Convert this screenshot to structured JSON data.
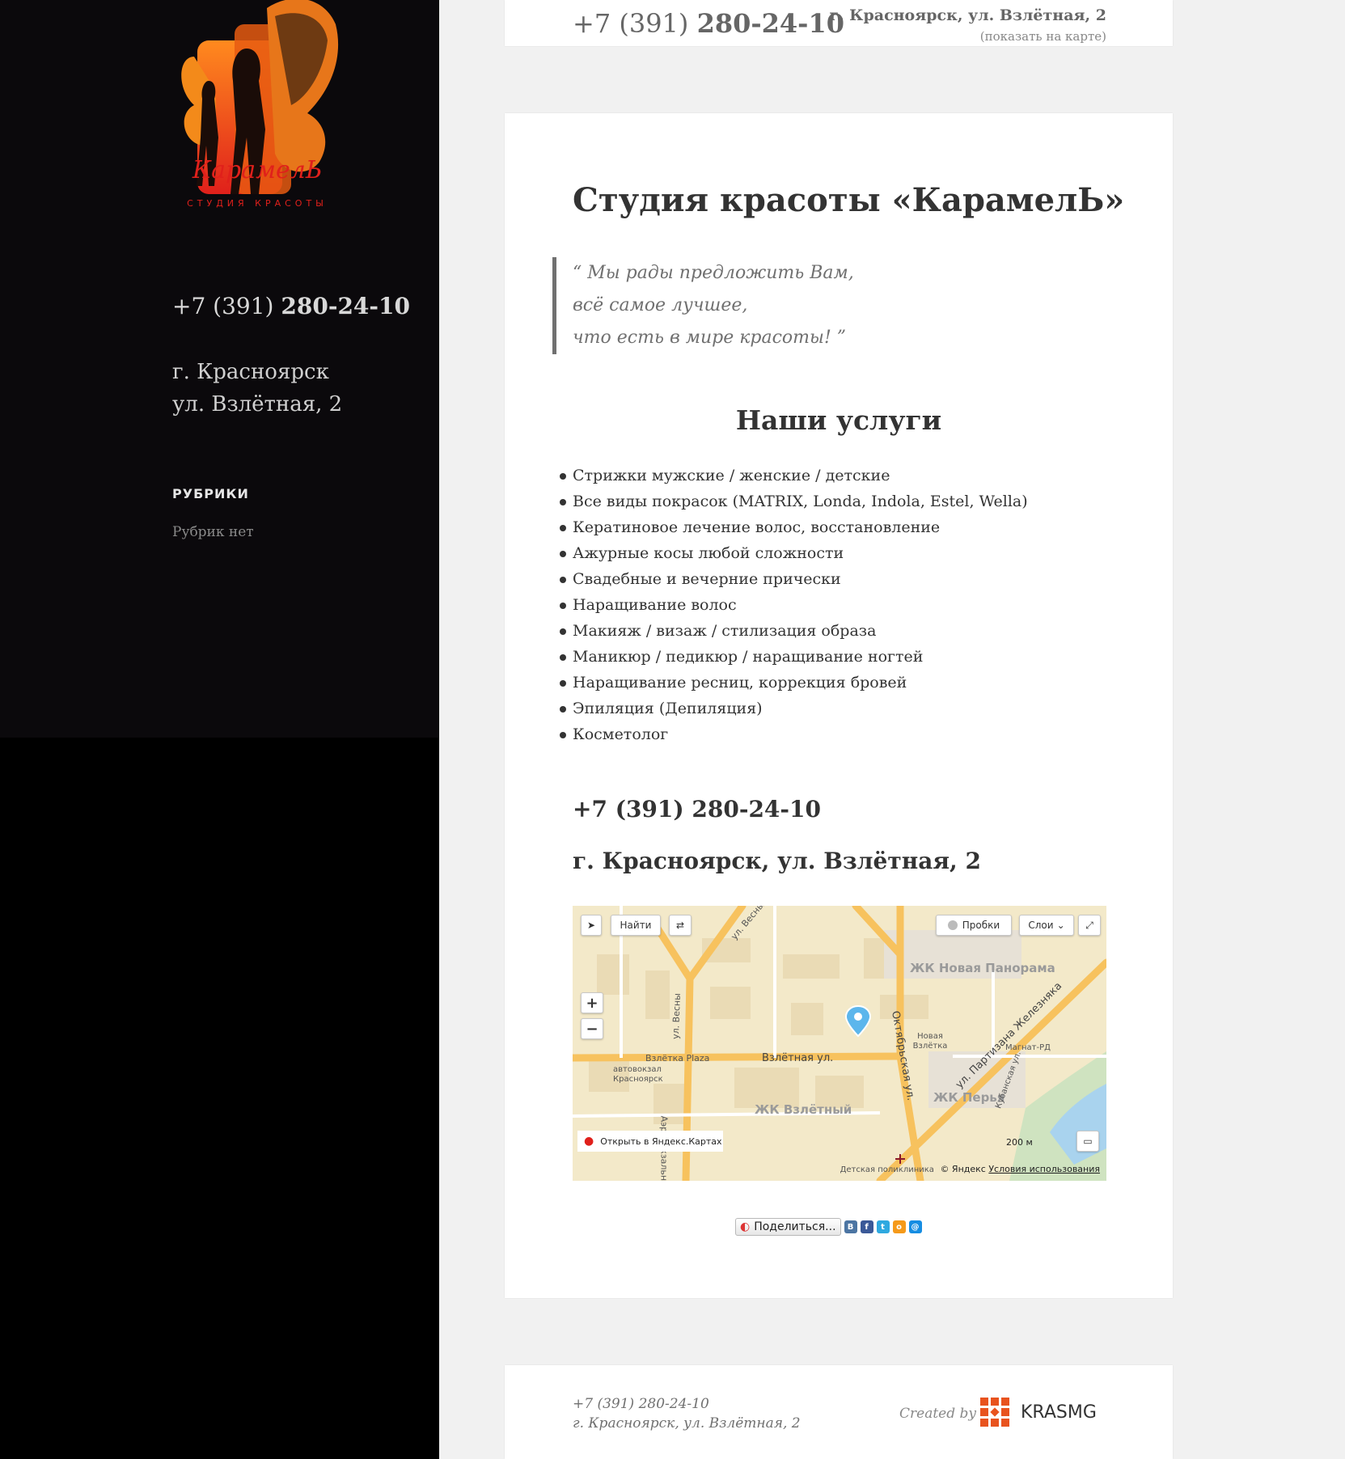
{
  "sidebar": {
    "logo_name": "КарамелЬ",
    "logo_subtitle": "СТУДИЯ КРАСОТЫ",
    "phone_prefix": "+7 (391) ",
    "phone_number": "280-24-10",
    "address_line1": "г. Красноярск",
    "address_line2": "ул. Взлётная, 2",
    "rubrics_heading": "РУБРИКИ",
    "rubrics_empty": "Рубрик нет"
  },
  "header_card": {
    "phone_prefix": "+7 (391) ",
    "phone_number": "280-24-10",
    "address": "г. Красноярск, ул. Взлётная, 2",
    "map_link": "(показать на карте)"
  },
  "main": {
    "title": "Студия красоты «КарамелЬ»",
    "quote_lines": [
      "“ Мы рады предложить Вам,",
      "всё самое лучшее,",
      "что есть в мире красоты! ”"
    ],
    "services_title": "Наши услуги",
    "services": [
      "Стрижки мужские / женские / детские",
      "Все виды покрасок (MATRIX, Londa, Indola, Estel, Wella)",
      "Кератиновое лечение волос, восстановление",
      "Ажурные косы любой сложности",
      "Свадебные и вечерние прически",
      "Наращивание волос",
      "Макияж / визаж / стилизация образа",
      "Маникюр / педикюр / наращивание ногтей",
      "Наращивание ресниц, коррекция бровей",
      "Эпиляция (Депиляция)",
      "Косметолог"
    ],
    "contact_phone": "+7 (391) 280-24-10",
    "contact_address": "г. Красноярск, ул. Взлётная, 2"
  },
  "map": {
    "find_button": "Найти",
    "traffic_button": "Пробки",
    "layers_button": "Слои",
    "open_link": "Открыть в Яндекс.Картах",
    "copyright": "© Яндекс",
    "terms": "Условия использования",
    "scale": "200 м",
    "labels": {
      "novaya_panorama": "ЖК Новая Панорама",
      "vzletny": "ЖК Взлётный",
      "perya": "ЖК Перья",
      "vzletnaya_st": "Взлётная ул.",
      "oktyabrskaya": "Октябрьская ул.",
      "partizana": "ул. Партизана Железняка",
      "vesny1": "ул. Весны",
      "vesny2": "ул. Весны",
      "vzletka_plaza": "Взлётка Plaza",
      "avtovokzal": "автовокзал Красноярск",
      "novaya_vzletka": "Новая Взлётка",
      "magnat": "Магнат-РД",
      "kubanskaya": "Кубанская ул.",
      "poliklinika": "Детская поликлиника",
      "aerovokzal": "Аэровокзальная"
    }
  },
  "share": {
    "label": "Поделиться...",
    "icons": [
      "vk-icon",
      "facebook-icon",
      "twitter-icon",
      "odnoklassniki-icon",
      "mail-icon"
    ]
  },
  "footer": {
    "phone": "+7 (391) 280-24-10",
    "address": "г. Красноярск, ул. Взлётная, 2",
    "created_by": "Created by",
    "brand": "KRASMG"
  },
  "colors": {
    "sidebar": "#0b090c",
    "logo_orange": "#f36a12",
    "logo_red": "#e0201b",
    "map_bg": "#f3e9c9",
    "road": "#f7c25e"
  }
}
